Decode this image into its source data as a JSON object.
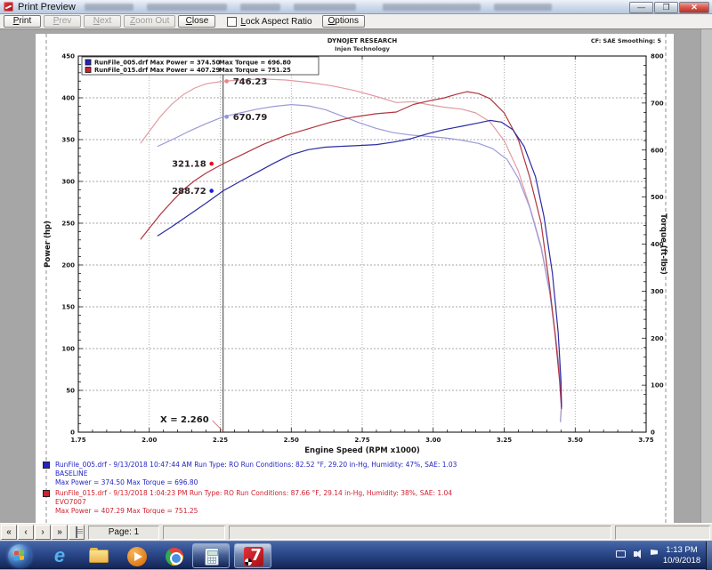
{
  "window": {
    "title": "Print Preview"
  },
  "toolbar": {
    "print": "Print",
    "prev": "Prev",
    "next": "Next",
    "zoom_out": "Zoom Out",
    "close": "Close",
    "lock_aspect": "Lock Aspect Ratio",
    "lock_aspect_checked": false,
    "options": "Options"
  },
  "page_header": {
    "line1": "DYNOJET RESEARCH",
    "line2": "Injen Technology",
    "right": "CF: SAE  Smoothing: 5"
  },
  "chart_data": {
    "type": "line",
    "title": "DYNOJET RESEARCH",
    "xlabel": "Engine Speed (RPM x1000)",
    "ylabel_left": "Power (hp)",
    "ylabel_right": "Torque (ft-lbs)",
    "xlim": [
      1.75,
      3.75
    ],
    "xticks": [
      1.75,
      2.0,
      2.25,
      2.5,
      2.75,
      3.0,
      3.25,
      3.5,
      3.75
    ],
    "ylim_left": [
      0,
      450
    ],
    "yticks_left": [
      0,
      50,
      100,
      150,
      200,
      250,
      300,
      350,
      400,
      450
    ],
    "ylim_right": [
      0,
      800
    ],
    "yticks_right": [
      0,
      100,
      200,
      300,
      400,
      500,
      600,
      700,
      800
    ],
    "grid": true,
    "legend_position": "top-left",
    "cursor_x": 2.26,
    "cursor_label": "X = 2.260",
    "legend": [
      {
        "color": "#2424c4",
        "text": "RunFile_005.drf Max Power = 374.50",
        "torque_text": "Max Torque = 696.80"
      },
      {
        "color": "#cf2130",
        "text": "RunFile_015.drf Max Power = 407.29",
        "torque_text": "Max Torque = 751.25"
      }
    ],
    "series": [
      {
        "name": "RunFile_015 torque",
        "axis": "right",
        "color": "#e39aa1",
        "dot_color": "#ef8287",
        "cursor_value": 746.23,
        "cursor_label": "746.23",
        "label_side": "right",
        "points": [
          [
            1.97,
            615
          ],
          [
            2.0,
            640
          ],
          [
            2.04,
            672
          ],
          [
            2.08,
            698
          ],
          [
            2.12,
            718
          ],
          [
            2.16,
            732
          ],
          [
            2.2,
            741
          ],
          [
            2.26,
            746.2
          ],
          [
            2.32,
            749
          ],
          [
            2.4,
            751.2
          ],
          [
            2.48,
            749
          ],
          [
            2.56,
            744
          ],
          [
            2.64,
            737
          ],
          [
            2.72,
            727
          ],
          [
            2.8,
            714
          ],
          [
            2.87,
            701
          ],
          [
            2.93,
            703
          ],
          [
            2.98,
            697
          ],
          [
            3.04,
            691
          ],
          [
            3.1,
            687
          ],
          [
            3.15,
            679
          ],
          [
            3.2,
            660
          ],
          [
            3.25,
            620
          ],
          [
            3.3,
            555
          ],
          [
            3.34,
            480
          ],
          [
            3.38,
            395
          ],
          [
            3.41,
            300
          ],
          [
            3.43,
            210
          ],
          [
            3.445,
            130
          ],
          [
            3.452,
            60
          ],
          [
            3.448,
            25
          ]
        ]
      },
      {
        "name": "RunFile_005 torque",
        "axis": "right",
        "color": "#9a9ad8",
        "dot_color": "#8f93e8",
        "cursor_value": 670.79,
        "cursor_label": "670.79",
        "label_side": "right",
        "points": [
          [
            2.03,
            608
          ],
          [
            2.08,
            622
          ],
          [
            2.14,
            640
          ],
          [
            2.2,
            656
          ],
          [
            2.26,
            670.8
          ],
          [
            2.32,
            679
          ],
          [
            2.38,
            687
          ],
          [
            2.44,
            693
          ],
          [
            2.5,
            696.8
          ],
          [
            2.56,
            694
          ],
          [
            2.62,
            686
          ],
          [
            2.68,
            672
          ],
          [
            2.74,
            658
          ],
          [
            2.8,
            646
          ],
          [
            2.86,
            637
          ],
          [
            2.92,
            632
          ],
          [
            2.98,
            629
          ],
          [
            3.04,
            626
          ],
          [
            3.1,
            621
          ],
          [
            3.16,
            614
          ],
          [
            3.21,
            603
          ],
          [
            3.26,
            580
          ],
          [
            3.3,
            540
          ],
          [
            3.34,
            478
          ],
          [
            3.38,
            392
          ],
          [
            3.41,
            298
          ],
          [
            3.43,
            208
          ],
          [
            3.445,
            128
          ],
          [
            3.452,
            58
          ],
          [
            3.448,
            22
          ]
        ]
      },
      {
        "name": "RunFile_015 power",
        "axis": "left",
        "color": "#b23440",
        "dot_color": "#e0111c",
        "cursor_value": 321.18,
        "cursor_label": "321.18",
        "label_side": "left",
        "points": [
          [
            1.97,
            231
          ],
          [
            2.0,
            244
          ],
          [
            2.04,
            261
          ],
          [
            2.08,
            276
          ],
          [
            2.12,
            290
          ],
          [
            2.16,
            301
          ],
          [
            2.2,
            310
          ],
          [
            2.26,
            321.2
          ],
          [
            2.32,
            331
          ],
          [
            2.4,
            344
          ],
          [
            2.48,
            355
          ],
          [
            2.56,
            363
          ],
          [
            2.64,
            371
          ],
          [
            2.72,
            377
          ],
          [
            2.8,
            381
          ],
          [
            2.87,
            383
          ],
          [
            2.93,
            392
          ],
          [
            2.98,
            396
          ],
          [
            3.04,
            400
          ],
          [
            3.08,
            404
          ],
          [
            3.12,
            407.3
          ],
          [
            3.16,
            405
          ],
          [
            3.2,
            399
          ],
          [
            3.25,
            382
          ],
          [
            3.3,
            350
          ],
          [
            3.34,
            305
          ],
          [
            3.38,
            250
          ],
          [
            3.41,
            175
          ],
          [
            3.43,
            115
          ],
          [
            3.445,
            62
          ],
          [
            3.452,
            28
          ]
        ]
      },
      {
        "name": "RunFile_005 power",
        "axis": "left",
        "color": "#2b2ba4",
        "dot_color": "#1c1cd8",
        "cursor_value": 288.72,
        "cursor_label": "288.72",
        "label_side": "left",
        "points": [
          [
            2.03,
            235
          ],
          [
            2.08,
            246
          ],
          [
            2.14,
            260
          ],
          [
            2.2,
            274
          ],
          [
            2.26,
            288.7
          ],
          [
            2.32,
            300
          ],
          [
            2.38,
            311
          ],
          [
            2.44,
            322
          ],
          [
            2.5,
            332
          ],
          [
            2.56,
            338
          ],
          [
            2.62,
            341
          ],
          [
            2.68,
            342
          ],
          [
            2.74,
            343
          ],
          [
            2.8,
            344
          ],
          [
            2.86,
            347
          ],
          [
            2.92,
            351
          ],
          [
            2.98,
            357
          ],
          [
            3.04,
            362
          ],
          [
            3.1,
            366
          ],
          [
            3.16,
            370
          ],
          [
            3.2,
            373
          ],
          [
            3.24,
            371
          ],
          [
            3.28,
            362
          ],
          [
            3.32,
            342
          ],
          [
            3.36,
            306
          ],
          [
            3.39,
            258
          ],
          [
            3.42,
            190
          ],
          [
            3.44,
            120
          ],
          [
            3.45,
            62
          ],
          [
            3.452,
            30
          ]
        ]
      }
    ]
  },
  "runs": [
    {
      "line1": "RunFile_005.drf - 9/13/2018 10:47:44 AM  Run Type: RO  Run Conditions: 82.52 °F, 29.20 in-Hg,  Humidity:  47%, SAE: 1.03",
      "name": "BASELINE",
      "line3": "Max Power = 374.50  Max Torque = 696.80"
    },
    {
      "line1": "RunFile_015.drf - 9/13/2018 1:04:23 PM  Run Type: RO  Run Conditions: 87.66 °F, 29.14 in-Hg,  Humidity:  38%, SAE: 1.04",
      "name": "EVO7007",
      "line3": "Max Power = 407.29  Max Torque = 751.25"
    }
  ],
  "statusbar": {
    "page_label": "Page: 1",
    "nav": {
      "first": "«",
      "prev": "‹",
      "next": "›",
      "last": "»"
    }
  },
  "taskbar": {
    "icons": [
      "start-orb",
      "internet-explorer",
      "windows-explorer",
      "media-player",
      "chrome",
      "calculator",
      "dynojet-winpep"
    ],
    "clock_time": "1:13 PM",
    "clock_date": "10/9/2018"
  }
}
